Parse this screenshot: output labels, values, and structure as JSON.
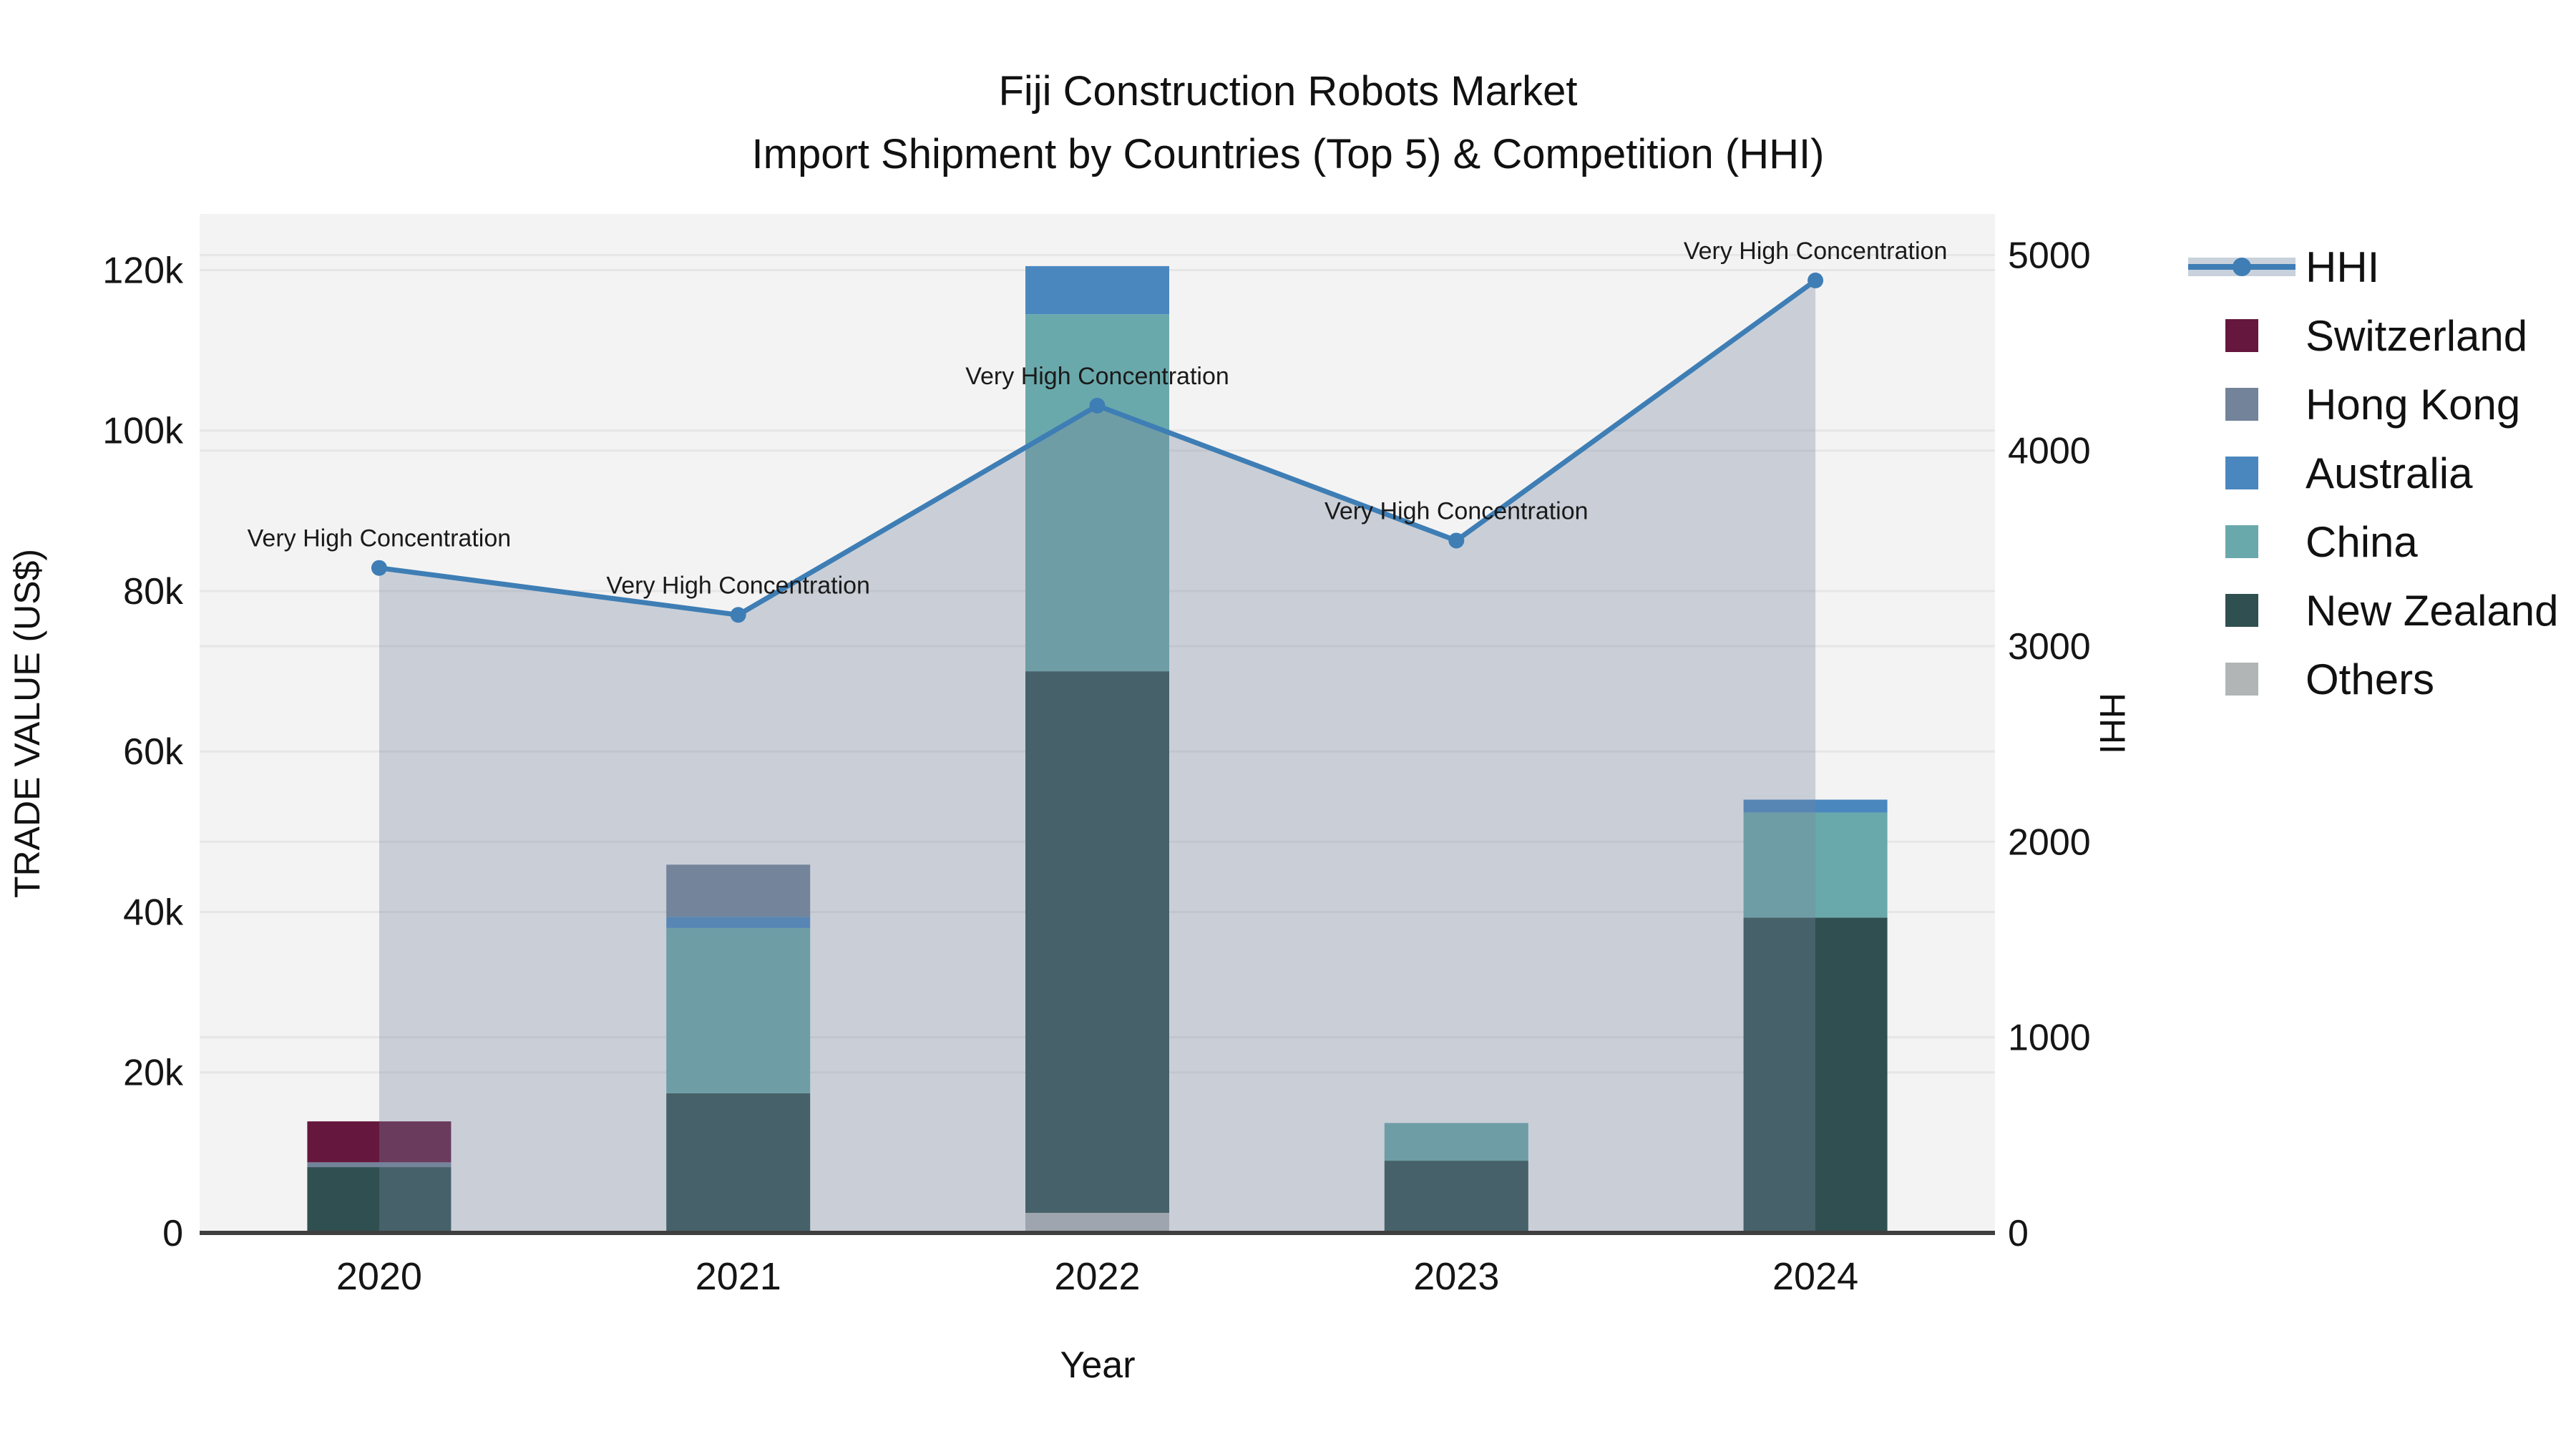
{
  "title": {
    "line1": "Fiji Construction Robots Market",
    "line2": "Import Shipment by Countries (Top 5) & Competition (HHI)"
  },
  "axes": {
    "left_title": "TRADE VALUE (US$)",
    "right_title": "HHI",
    "x_title": "Year",
    "left_ticks": [
      {
        "v": 0,
        "label": "0"
      },
      {
        "v": 20000,
        "label": "20k"
      },
      {
        "v": 40000,
        "label": "40k"
      },
      {
        "v": 60000,
        "label": "60k"
      },
      {
        "v": 80000,
        "label": "80k"
      },
      {
        "v": 100000,
        "label": "100k"
      },
      {
        "v": 120000,
        "label": "120k"
      }
    ],
    "right_ticks": [
      {
        "v": 0,
        "label": "0"
      },
      {
        "v": 1000,
        "label": "1000"
      },
      {
        "v": 2000,
        "label": "2000"
      },
      {
        "v": 3000,
        "label": "3000"
      },
      {
        "v": 4000,
        "label": "4000"
      },
      {
        "v": 5000,
        "label": "5000"
      }
    ]
  },
  "legend": {
    "items": [
      {
        "label": "HHI",
        "type": "line",
        "color": "#3e7eb5",
        "band": "#c8d1dc"
      },
      {
        "label": "Switzerland",
        "type": "square",
        "color": "#65173e"
      },
      {
        "label": "Hong Kong",
        "type": "square",
        "color": "#72839a"
      },
      {
        "label": "Australia",
        "type": "square",
        "color": "#4a87bf"
      },
      {
        "label": "China",
        "type": "square",
        "color": "#6aa9ab"
      },
      {
        "label": "New Zealand",
        "type": "square",
        "color": "#2f4f50"
      },
      {
        "label": "Others",
        "type": "square",
        "color": "#b2b5b6"
      }
    ]
  },
  "chart_data": {
    "type": "bar+line",
    "categories": [
      "2020",
      "2021",
      "2022",
      "2023",
      "2024"
    ],
    "bar_series": [
      {
        "name": "Others",
        "color": "#b2b5b6",
        "values": [
          0,
          0,
          2500,
          0,
          0
        ]
      },
      {
        "name": "New Zealand",
        "color": "#2f4f50",
        "values": [
          8200,
          17400,
          67500,
          9000,
          39300
        ]
      },
      {
        "name": "China",
        "color": "#6aa9ab",
        "values": [
          0,
          20600,
          44500,
          4700,
          13100
        ]
      },
      {
        "name": "Australia",
        "color": "#4a87bf",
        "values": [
          0,
          1400,
          6000,
          0,
          1600
        ]
      },
      {
        "name": "Hong Kong",
        "color": "#72839a",
        "values": [
          600,
          6500,
          0,
          0,
          0
        ]
      },
      {
        "name": "Switzerland",
        "color": "#65173e",
        "values": [
          5100,
          0,
          0,
          0,
          0
        ]
      }
    ],
    "bar_totals": [
      13900,
      45900,
      120500,
      13700,
      54000
    ],
    "line_series": {
      "name": "HHI",
      "color": "#3e7eb5",
      "area_fill": "rgba(119,134,158,0.33)",
      "values": [
        3400,
        3160,
        4230,
        3540,
        4870
      ]
    },
    "annotations": [
      "Very High Concentration",
      "Very High Concentration",
      "Very High Concentration",
      "Very High Concentration",
      "Very High Concentration"
    ],
    "xlabel": "Year",
    "ylabel_left": "TRADE VALUE (US$)",
    "ylabel_right": "HHI",
    "ylim_left": [
      0,
      127000
    ],
    "ylim_right": [
      0,
      5210
    ],
    "grid": true,
    "legend_position": "right",
    "plot_bg": "#f4f3f3",
    "grid_color": "#e6e6e6",
    "axisline_color": "#3f3f3f",
    "tick_color": "#151515"
  }
}
